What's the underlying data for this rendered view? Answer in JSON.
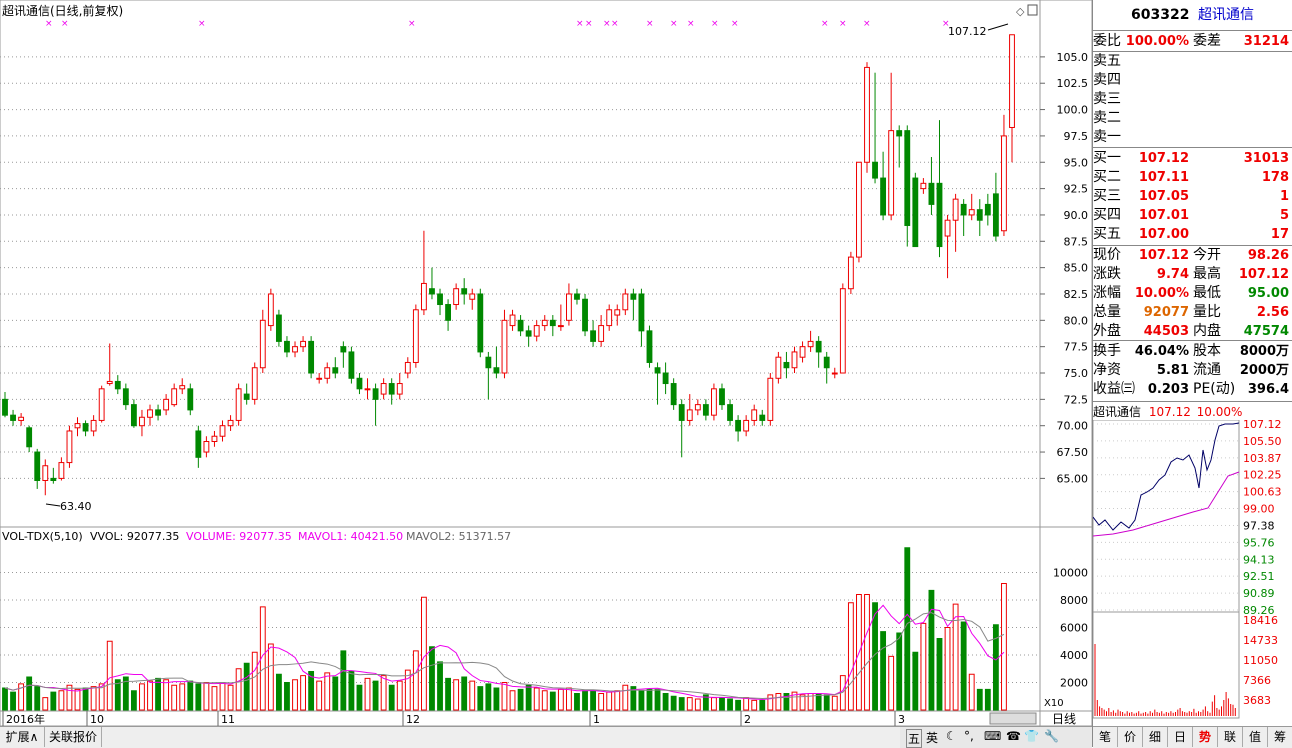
{
  "chart_title": "超讯通信(日线,前复权)",
  "current_price_label": "107.12",
  "low_label": "63.40",
  "price_axis": {
    "min": 62.0,
    "max": 108.5,
    "ticks": [
      "105.0",
      "102.5",
      "100.0",
      "97.5",
      "95.0",
      "92.5",
      "90.0",
      "87.5",
      "85.0",
      "82.5",
      "80.0",
      "77.5",
      "75.0",
      "72.5",
      "70.00",
      "67.50",
      "65.00"
    ]
  },
  "volume_header": {
    "indicator": "VOL-TDX(5,10)",
    "vvol": "VVOL: 92077.35",
    "volume": "VOLUME: 92077.35",
    "mavol1": "MAVOL1: 40421.50",
    "mavol2": "MAVOL2: 51371.57"
  },
  "volume_axis": {
    "ticks": [
      "10000",
      "8000",
      "6000",
      "4000",
      "2000"
    ],
    "unit": "X10"
  },
  "date_axis": {
    "labels": [
      "2016年",
      "10",
      "11",
      "12",
      "1",
      "2",
      "3"
    ]
  },
  "period_label": "日线",
  "bottom_tabs": [
    "扩展∧",
    "关联报价"
  ],
  "status_icons": [
    "五",
    "英",
    "☾",
    "°,",
    "⌨",
    "☎",
    "👕",
    "🔧"
  ],
  "side": {
    "code": "603322",
    "name": "超讯通信",
    "weibi_label": "委比",
    "weibi": "100.00%",
    "weicha_label": "委差",
    "weicha": "31214",
    "sells": [
      {
        "label": "卖五",
        "price": "",
        "vol": ""
      },
      {
        "label": "卖四",
        "price": "",
        "vol": ""
      },
      {
        "label": "卖三",
        "price": "",
        "vol": ""
      },
      {
        "label": "卖二",
        "price": "",
        "vol": ""
      },
      {
        "label": "卖一",
        "price": "",
        "vol": ""
      }
    ],
    "buys": [
      {
        "label": "买一",
        "price": "107.12",
        "vol": "31013"
      },
      {
        "label": "买二",
        "price": "107.11",
        "vol": "178"
      },
      {
        "label": "买三",
        "price": "107.05",
        "vol": "1"
      },
      {
        "label": "买四",
        "price": "107.01",
        "vol": "5"
      },
      {
        "label": "买五",
        "price": "107.00",
        "vol": "17"
      }
    ],
    "quote": [
      {
        "l1": "现价",
        "v1": "107.12",
        "c1": "red",
        "l2": "今开",
        "v2": "98.26",
        "c2": "red"
      },
      {
        "l1": "涨跌",
        "v1": "9.74",
        "c1": "red",
        "l2": "最高",
        "v2": "107.12",
        "c2": "red"
      },
      {
        "l1": "涨幅",
        "v1": "10.00%",
        "c1": "red",
        "l2": "最低",
        "v2": "95.00",
        "c2": "green"
      },
      {
        "l1": "总量",
        "v1": "92077",
        "c1": "orange",
        "l2": "量比",
        "v2": "2.56",
        "c2": "red"
      },
      {
        "l1": "外盘",
        "v1": "44503",
        "c1": "red",
        "l2": "内盘",
        "v2": "47574",
        "c2": "green"
      }
    ],
    "fundamentals": [
      {
        "l1": "换手",
        "v1": "46.04%",
        "l2": "股本",
        "v2": "8000万"
      },
      {
        "l1": "净资",
        "v1": "5.81",
        "l2": "流通",
        "v2": "2000万"
      },
      {
        "l1": "收益㈢",
        "v1": "0.203",
        "l2": "PE(动)",
        "v2": "396.4"
      }
    ],
    "mini_title": "超讯通信",
    "mini_price": "107.12",
    "mini_pct": "10.00%",
    "mini_price_ticks": [
      "107.12",
      "105.50",
      "103.87",
      "102.25",
      "100.63",
      "99.00",
      "97.38",
      "95.76",
      "94.13",
      "92.51",
      "90.89",
      "89.26"
    ],
    "mini_vol_ticks": [
      "18416",
      "14733",
      "11050",
      "7366",
      "3683"
    ],
    "tabs": [
      "笔",
      "价",
      "细",
      "日",
      "势",
      "联",
      "值",
      "筹"
    ]
  },
  "chart_data": {
    "type": "candlestick",
    "title": "超讯通信(日线,前复权)",
    "candles": [
      [
        72.5,
        71.0,
        73.2,
        70.8
      ],
      [
        71.0,
        70.5,
        71.5,
        70.0
      ],
      [
        70.5,
        70.8,
        71.2,
        70.0
      ],
      [
        69.8,
        68.0,
        70.0,
        67.5
      ],
      [
        67.5,
        64.8,
        67.8,
        64.0
      ],
      [
        64.8,
        66.2,
        66.8,
        63.4
      ],
      [
        65.0,
        64.8,
        66.0,
        64.5
      ],
      [
        65.0,
        66.5,
        67.0,
        64.8
      ],
      [
        66.5,
        69.5,
        70.0,
        66.0
      ],
      [
        69.8,
        70.2,
        70.8,
        69.0
      ],
      [
        70.2,
        69.5,
        70.5,
        69.0
      ],
      [
        69.5,
        70.5,
        71.0,
        69.0
      ],
      [
        70.5,
        73.5,
        73.8,
        70.3
      ],
      [
        74.0,
        74.2,
        77.8,
        73.8
      ],
      [
        74.2,
        73.5,
        74.8,
        73.0
      ],
      [
        73.5,
        72.0,
        74.0,
        71.5
      ],
      [
        72.0,
        70.0,
        72.5,
        69.8
      ],
      [
        70.0,
        70.8,
        71.5,
        69.0
      ],
      [
        70.8,
        71.5,
        72.0,
        70.0
      ],
      [
        71.5,
        71.0,
        72.0,
        70.5
      ],
      [
        71.5,
        72.5,
        73.0,
        71.0
      ],
      [
        72.0,
        73.5,
        74.0,
        71.8
      ],
      [
        73.5,
        73.8,
        74.5,
        73.0
      ],
      [
        73.5,
        71.5,
        74.0,
        71.0
      ],
      [
        69.5,
        67.0,
        70.0,
        66.0
      ],
      [
        67.5,
        68.5,
        69.0,
        67.0
      ],
      [
        68.5,
        69.0,
        69.5,
        68.0
      ],
      [
        69.0,
        70.0,
        70.5,
        68.5
      ],
      [
        70.0,
        70.5,
        71.0,
        69.5
      ],
      [
        70.5,
        73.5,
        74.0,
        70.0
      ],
      [
        73.0,
        72.5,
        74.0,
        72.0
      ],
      [
        72.5,
        75.5,
        76.0,
        72.0
      ],
      [
        75.5,
        80.0,
        81.0,
        75.0
      ],
      [
        79.5,
        82.5,
        83.0,
        79.0
      ],
      [
        80.5,
        78.0,
        81.0,
        77.5
      ],
      [
        78.0,
        77.0,
        78.5,
        76.5
      ],
      [
        77.0,
        77.5,
        78.0,
        76.5
      ],
      [
        77.5,
        78.0,
        78.5,
        77.0
      ],
      [
        78.0,
        75.0,
        78.5,
        74.5
      ],
      [
        74.5,
        74.5,
        75.0,
        74.0
      ],
      [
        74.5,
        75.5,
        76.0,
        74.0
      ],
      [
        75.5,
        75.0,
        76.5,
        74.5
      ],
      [
        77.5,
        77.0,
        78.0,
        75.5
      ],
      [
        77.0,
        74.5,
        77.5,
        74.0
      ],
      [
        74.5,
        73.5,
        75.0,
        73.0
      ],
      [
        73.5,
        73.5,
        74.5,
        72.5
      ],
      [
        73.5,
        72.5,
        74.0,
        70.0
      ],
      [
        73.0,
        74.0,
        74.5,
        72.5
      ],
      [
        74.0,
        73.0,
        74.5,
        72.0
      ],
      [
        73.0,
        74.0,
        75.0,
        72.5
      ],
      [
        75.0,
        76.0,
        76.5,
        74.5
      ],
      [
        76.0,
        81.0,
        81.5,
        75.5
      ],
      [
        81.0,
        83.5,
        88.5,
        80.5
      ],
      [
        83.0,
        82.5,
        85.0,
        82.0
      ],
      [
        82.5,
        81.5,
        83.0,
        80.5
      ],
      [
        81.5,
        80.0,
        82.0,
        79.0
      ],
      [
        81.5,
        83.0,
        83.5,
        81.0
      ],
      [
        83.0,
        82.5,
        84.0,
        81.5
      ],
      [
        82.0,
        82.5,
        83.0,
        81.0
      ],
      [
        82.5,
        77.0,
        83.0,
        76.5
      ],
      [
        76.5,
        75.5,
        77.0,
        72.5
      ],
      [
        75.5,
        75.0,
        77.5,
        74.5
      ],
      [
        75.0,
        80.0,
        81.0,
        74.5
      ],
      [
        79.5,
        80.5,
        81.0,
        79.0
      ],
      [
        80.0,
        79.0,
        80.5,
        78.5
      ],
      [
        79.0,
        78.5,
        79.5,
        77.5
      ],
      [
        78.5,
        79.5,
        80.0,
        78.0
      ],
      [
        79.5,
        80.0,
        80.5,
        79.0
      ],
      [
        80.0,
        79.5,
        80.5,
        78.5
      ],
      [
        79.5,
        79.5,
        81.5,
        79.0
      ],
      [
        80.0,
        82.5,
        83.5,
        79.5
      ],
      [
        82.5,
        82.0,
        83.0,
        81.5
      ],
      [
        82.0,
        79.0,
        82.5,
        78.5
      ],
      [
        79.0,
        78.0,
        80.0,
        77.5
      ],
      [
        78.0,
        79.5,
        80.5,
        77.5
      ],
      [
        79.5,
        81.0,
        81.5,
        79.0
      ],
      [
        80.5,
        81.0,
        81.5,
        79.5
      ],
      [
        81.0,
        82.5,
        83.0,
        80.5
      ],
      [
        82.5,
        82.0,
        83.0,
        80.0
      ],
      [
        82.5,
        79.0,
        83.0,
        77.5
      ],
      [
        79.0,
        76.0,
        79.5,
        75.5
      ],
      [
        75.5,
        75.0,
        76.0,
        72.0
      ],
      [
        75.0,
        74.0,
        76.0,
        73.0
      ],
      [
        74.0,
        72.0,
        74.5,
        71.5
      ],
      [
        72.0,
        70.5,
        72.5,
        67.0
      ],
      [
        70.5,
        71.5,
        73.0,
        70.0
      ],
      [
        71.5,
        72.0,
        72.5,
        71.0
      ],
      [
        72.0,
        71.0,
        72.5,
        70.5
      ],
      [
        71.0,
        73.5,
        74.0,
        70.5
      ],
      [
        73.5,
        72.0,
        74.0,
        71.5
      ],
      [
        72.0,
        70.5,
        72.5,
        70.0
      ],
      [
        70.5,
        69.5,
        71.0,
        68.5
      ],
      [
        69.5,
        70.5,
        71.0,
        69.0
      ],
      [
        70.5,
        71.5,
        72.0,
        70.0
      ],
      [
        71.0,
        70.5,
        71.5,
        70.0
      ],
      [
        70.5,
        74.5,
        75.0,
        70.0
      ],
      [
        74.5,
        76.5,
        77.0,
        74.0
      ],
      [
        76.0,
        75.5,
        77.0,
        74.5
      ],
      [
        75.5,
        77.0,
        77.5,
        75.0
      ],
      [
        76.5,
        77.5,
        78.0,
        76.0
      ],
      [
        77.5,
        78.0,
        79.0,
        77.0
      ],
      [
        78.0,
        77.0,
        78.5,
        75.5
      ],
      [
        76.5,
        75.5,
        77.0,
        74.0
      ],
      [
        75.0,
        75.0,
        75.5,
        74.5
      ],
      [
        75.0,
        83.0,
        83.5,
        75.0
      ],
      [
        83.0,
        86.0,
        86.5,
        82.5
      ],
      [
        86.0,
        95.0,
        95.0,
        85.5
      ],
      [
        95.0,
        104.0,
        104.5,
        94.0
      ],
      [
        95.0,
        93.5,
        103.5,
        93.0
      ],
      [
        93.5,
        90.0,
        96.0,
        89.5
      ],
      [
        90.0,
        98.0,
        103.5,
        89.5
      ],
      [
        98.0,
        97.5,
        98.5,
        94.5
      ],
      [
        98.0,
        89.0,
        98.5,
        87.0
      ],
      [
        93.5,
        87.0,
        94.0,
        87.0
      ],
      [
        92.5,
        93.0,
        93.5,
        92.0
      ],
      [
        93.0,
        91.0,
        95.5,
        90.0
      ],
      [
        93.0,
        87.0,
        99.0,
        86.0
      ],
      [
        88.0,
        89.5,
        90.0,
        84.0
      ],
      [
        89.5,
        91.5,
        92.0,
        86.5
      ],
      [
        91.0,
        90.0,
        91.5,
        88.0
      ],
      [
        90.0,
        90.5,
        92.0,
        89.5
      ],
      [
        90.5,
        89.5,
        91.5,
        88.0
      ],
      [
        91.0,
        90.0,
        92.0,
        89.0
      ],
      [
        92.0,
        88.0,
        94.0,
        87.5
      ],
      [
        88.5,
        97.5,
        99.5,
        88.0
      ],
      [
        98.3,
        107.1,
        107.1,
        95.0
      ]
    ],
    "volumes": [
      1600,
      1300,
      1900,
      2400,
      1700,
      900,
      1300,
      1400,
      1800,
      1500,
      1600,
      1700,
      1900,
      5000,
      2200,
      2400,
      1400,
      1900,
      2100,
      2300,
      2200,
      1800,
      1900,
      2100,
      1900,
      2000,
      1700,
      2000,
      1800,
      3000,
      3400,
      4200,
      7500,
      4800,
      2600,
      2000,
      2200,
      2500,
      2800,
      2100,
      2700,
      2400,
      4300,
      2800,
      1800,
      2300,
      2100,
      2500,
      1800,
      2100,
      2900,
      4300,
      8200,
      4600,
      3500,
      2300,
      2200,
      2400,
      2100,
      1700,
      1900,
      1600,
      2000,
      1400,
      1500,
      1800,
      1600,
      1400,
      1300,
      1500,
      1600,
      1200,
      1400,
      1400,
      1200,
      1300,
      1400,
      1800,
      1700,
      1400,
      1500,
      1500,
      1200,
      1000,
      900,
      900,
      800,
      1100,
      900,
      900,
      800,
      700,
      900,
      700,
      700,
      1100,
      1200,
      1200,
      1300,
      1100,
      1200,
      1200,
      1100,
      1000,
      2500,
      7800,
      8400,
      8400,
      7800,
      5700,
      3900,
      5600,
      11800,
      4200,
      6300,
      8700,
      5200,
      6000,
      7700,
      6400,
      2600,
      1500,
      1500,
      6200,
      9200
    ],
    "ma_volume_lines": [
      "MAVOL1",
      "MAVOL2"
    ],
    "y_range": [
      62.0,
      108.5
    ],
    "vol_range": [
      0,
      12000
    ],
    "annotations": [
      "107.12",
      "63.40"
    ],
    "marker_xs": [
      48,
      64,
      201,
      411,
      579,
      588,
      606,
      614,
      649,
      673,
      690,
      714,
      734,
      824,
      842,
      866,
      945
    ]
  }
}
